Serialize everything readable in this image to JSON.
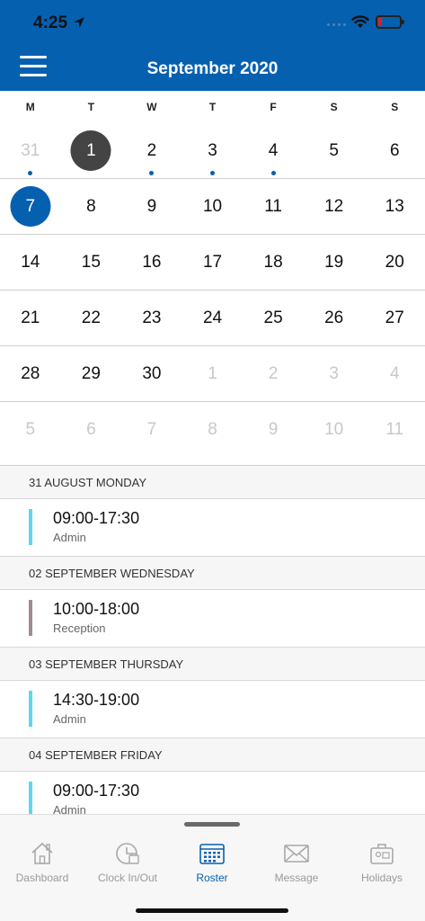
{
  "status": {
    "time": "4:25"
  },
  "header": {
    "title": "September 2020"
  },
  "weekdays": [
    "M",
    "T",
    "W",
    "T",
    "F",
    "S",
    "S"
  ],
  "calendar": {
    "weeks": [
      [
        {
          "d": "31",
          "muted": true,
          "dot": true
        },
        {
          "d": "1",
          "today": true
        },
        {
          "d": "2",
          "dot": true
        },
        {
          "d": "3",
          "dot": true
        },
        {
          "d": "4",
          "dot": true
        },
        {
          "d": "5"
        },
        {
          "d": "6"
        }
      ],
      [
        {
          "d": "7",
          "selected": true
        },
        {
          "d": "8"
        },
        {
          "d": "9"
        },
        {
          "d": "10"
        },
        {
          "d": "11"
        },
        {
          "d": "12"
        },
        {
          "d": "13"
        }
      ],
      [
        {
          "d": "14"
        },
        {
          "d": "15"
        },
        {
          "d": "16"
        },
        {
          "d": "17"
        },
        {
          "d": "18"
        },
        {
          "d": "19"
        },
        {
          "d": "20"
        }
      ],
      [
        {
          "d": "21"
        },
        {
          "d": "22"
        },
        {
          "d": "23"
        },
        {
          "d": "24"
        },
        {
          "d": "25"
        },
        {
          "d": "26"
        },
        {
          "d": "27"
        }
      ],
      [
        {
          "d": "28"
        },
        {
          "d": "29"
        },
        {
          "d": "30"
        },
        {
          "d": "1",
          "muted": true
        },
        {
          "d": "2",
          "muted": true
        },
        {
          "d": "3",
          "muted": true
        },
        {
          "d": "4",
          "muted": true
        }
      ],
      [
        {
          "d": "5",
          "muted": true
        },
        {
          "d": "6",
          "muted": true
        },
        {
          "d": "7",
          "muted": true
        },
        {
          "d": "8",
          "muted": true
        },
        {
          "d": "9",
          "muted": true
        },
        {
          "d": "10",
          "muted": true
        },
        {
          "d": "11",
          "muted": true
        }
      ]
    ]
  },
  "roster": [
    {
      "header": "31 AUGUST MONDAY",
      "time": "09:00-17:30",
      "role": "Admin",
      "color": "#5ad8f0"
    },
    {
      "header": "02 SEPTEMBER WEDNESDAY",
      "time": "10:00-18:00",
      "role": "Reception",
      "color": "#a08c90"
    },
    {
      "header": "03 SEPTEMBER THURSDAY",
      "time": "14:30-19:00",
      "role": "Admin",
      "color": "#5ad8f0"
    },
    {
      "header": "04 SEPTEMBER FRIDAY",
      "time": "09:00-17:30",
      "role": "Admin",
      "color": "#5ad8f0"
    }
  ],
  "tabs": [
    {
      "label": "Dashboard",
      "icon": "home-icon",
      "active": false
    },
    {
      "label": "Clock In/Out",
      "icon": "clock-icon",
      "active": false
    },
    {
      "label": "Roster",
      "icon": "calendar-icon",
      "active": true
    },
    {
      "label": "Message",
      "icon": "envelope-icon",
      "active": false
    },
    {
      "label": "Holidays",
      "icon": "suitcase-icon",
      "active": false
    }
  ],
  "colors": {
    "brand": "#0560b0",
    "today": "#444444"
  }
}
